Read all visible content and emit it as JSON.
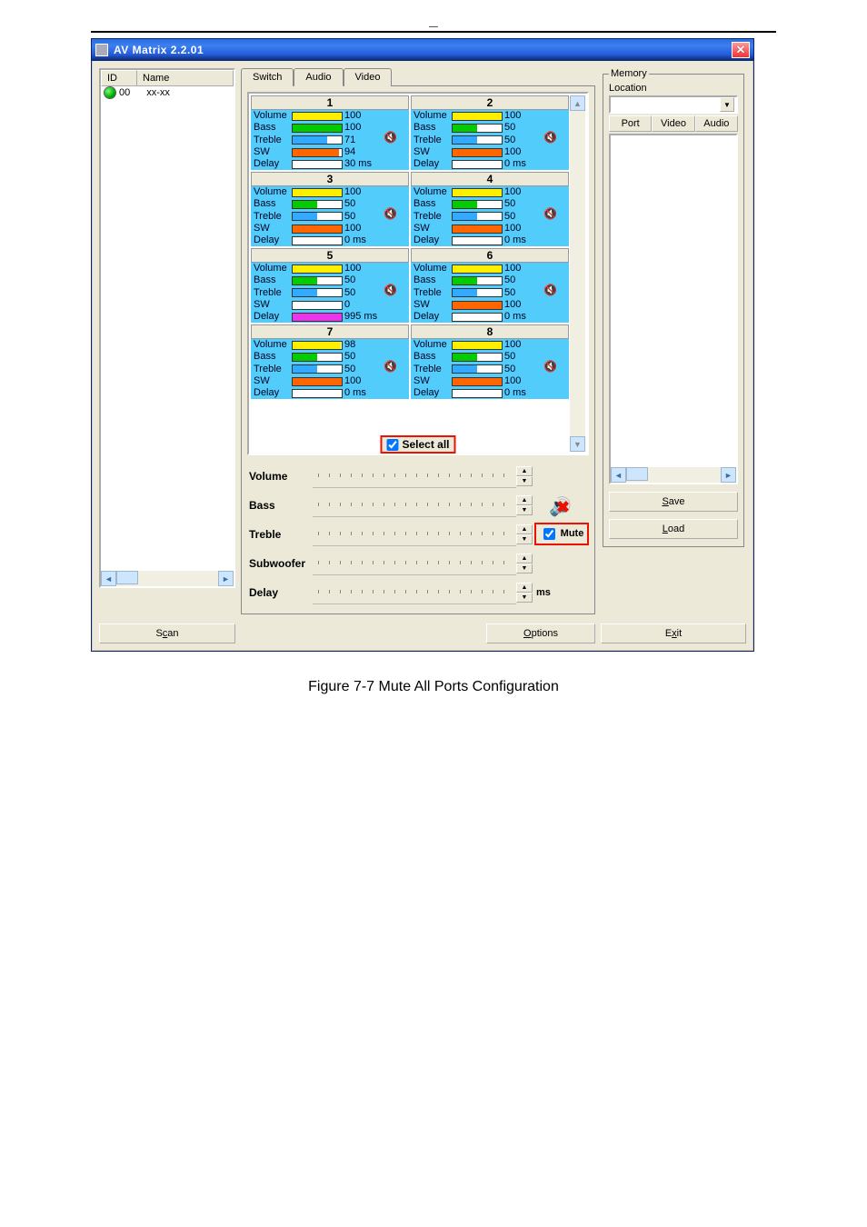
{
  "window": {
    "title": "AV Matrix 2.2.01"
  },
  "caption": "Figure 7-7 Mute All Ports Configuration",
  "listpanel": {
    "col_id": "ID",
    "col_name": "Name",
    "row_id": "00",
    "row_name": "xx-xx"
  },
  "tabs": {
    "t1": "Switch",
    "t2": "Audio",
    "t3": "Video"
  },
  "cards": [
    {
      "n": "1",
      "vol": 100,
      "bass": 100,
      "treb": 71,
      "sw": 94,
      "delay": "30 ms",
      "bars": {
        "vol": [
          "#fe0",
          100
        ],
        "bass": [
          "#0c0",
          100
        ],
        "treb": [
          "#3af",
          71
        ],
        "sw": [
          "#f60",
          94
        ],
        "delay": [
          "#fff",
          3
        ]
      }
    },
    {
      "n": "2",
      "vol": 100,
      "bass": 50,
      "treb": 50,
      "sw": 100,
      "delay": "0 ms",
      "bars": {
        "vol": [
          "#fe0",
          100
        ],
        "bass": [
          "#0c0",
          50
        ],
        "treb": [
          "#3af",
          50
        ],
        "sw": [
          "#f60",
          100
        ],
        "delay": [
          "#fff",
          0
        ]
      }
    },
    {
      "n": "3",
      "vol": 100,
      "bass": 50,
      "treb": 50,
      "sw": 100,
      "delay": "0 ms",
      "bars": {
        "vol": [
          "#fe0",
          100
        ],
        "bass": [
          "#0c0",
          50
        ],
        "treb": [
          "#3af",
          50
        ],
        "sw": [
          "#f60",
          100
        ],
        "delay": [
          "#fff",
          0
        ]
      }
    },
    {
      "n": "4",
      "vol": 100,
      "bass": 50,
      "treb": 50,
      "sw": 100,
      "delay": "0 ms",
      "bars": {
        "vol": [
          "#fe0",
          100
        ],
        "bass": [
          "#0c0",
          50
        ],
        "treb": [
          "#3af",
          50
        ],
        "sw": [
          "#f60",
          100
        ],
        "delay": [
          "#fff",
          0
        ]
      }
    },
    {
      "n": "5",
      "vol": 100,
      "bass": 50,
      "treb": 50,
      "sw": 0,
      "delay": "995 ms",
      "bars": {
        "vol": [
          "#fe0",
          100
        ],
        "bass": [
          "#0c0",
          50
        ],
        "treb": [
          "#3af",
          50
        ],
        "sw": [
          "#fff",
          0
        ],
        "delay": [
          "#e3e",
          100
        ]
      }
    },
    {
      "n": "6",
      "vol": 100,
      "bass": 50,
      "treb": 50,
      "sw": 100,
      "delay": "0 ms",
      "bars": {
        "vol": [
          "#fe0",
          100
        ],
        "bass": [
          "#0c0",
          50
        ],
        "treb": [
          "#3af",
          50
        ],
        "sw": [
          "#f60",
          100
        ],
        "delay": [
          "#fff",
          0
        ]
      }
    },
    {
      "n": "7",
      "vol": 98,
      "bass": 50,
      "treb": 50,
      "sw": 100,
      "delay": "0 ms",
      "bars": {
        "vol": [
          "#fe0",
          98
        ],
        "bass": [
          "#0c0",
          50
        ],
        "treb": [
          "#3af",
          50
        ],
        "sw": [
          "#f60",
          100
        ],
        "delay": [
          "#fff",
          0
        ]
      }
    },
    {
      "n": "8",
      "vol": 100,
      "bass": 50,
      "treb": 50,
      "sw": 100,
      "delay": "0 ms",
      "bars": {
        "vol": [
          "#fe0",
          100
        ],
        "bass": [
          "#0c0",
          50
        ],
        "treb": [
          "#3af",
          50
        ],
        "sw": [
          "#f60",
          100
        ],
        "delay": [
          "#fff",
          0
        ]
      }
    }
  ],
  "param_labels": {
    "vol": "Volume",
    "bass": "Bass",
    "treb": "Treble",
    "sw": "SW",
    "delay": "Delay"
  },
  "selectall": "Select all",
  "global": {
    "volume": "Volume",
    "bass": "Bass",
    "treble": "Treble",
    "sub": "Subwoofer",
    "delay": "Delay",
    "ms": "ms",
    "mute": "Mute"
  },
  "memory": {
    "legend": "Memory",
    "loc": "Location",
    "c1": "Port",
    "c2": "Video",
    "c3": "Audio",
    "save": "Save",
    "load": "Load"
  },
  "footer": {
    "scan": "Scan",
    "options": "Options",
    "exit": "Exit"
  }
}
